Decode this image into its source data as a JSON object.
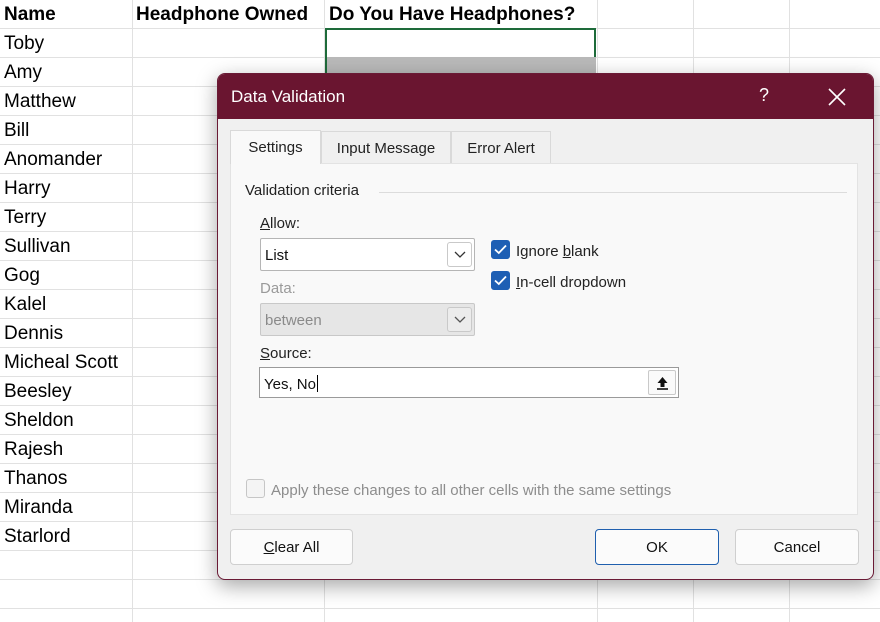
{
  "sheet": {
    "headers": [
      "Name",
      "Headphone Owned",
      "Do You Have Headphones?"
    ],
    "names": [
      "Toby",
      "Amy",
      "Matthew",
      "Bill",
      "Anomander",
      "Harry",
      "Terry",
      "Sullivan",
      "Gog",
      "Kalel",
      "Dennis",
      "Micheal Scott",
      "Beesley",
      "Sheldon",
      "Rajesh",
      "Thanos",
      "Miranda",
      "Starlord"
    ]
  },
  "dialog": {
    "title": "Data Validation",
    "help": "?",
    "tabs": [
      "Settings",
      "Input Message",
      "Error Alert"
    ],
    "active_tab": "Settings",
    "group_label": "Validation criteria",
    "allow_label_pre": "",
    "allow_label_acc": "A",
    "allow_label_post": "llow:",
    "allow_value": "List",
    "data_label": "Data:",
    "data_value": "between",
    "source_label_acc": "S",
    "source_label_post": "ource:",
    "source_value": "Yes, No",
    "ignore_blank_pre": "Ignore ",
    "ignore_blank_acc": "b",
    "ignore_blank_post": "lank",
    "ignore_blank_checked": true,
    "incell_acc": "I",
    "incell_post": "n-cell dropdown",
    "incell_checked": true,
    "apply_all_label": "Apply these changes to all other cells with the same settings",
    "apply_all_checked": false,
    "clear_acc": "C",
    "clear_post": "lear All",
    "ok_label": "OK",
    "cancel_label": "Cancel"
  },
  "colors": {
    "titlebar": "#6a1530",
    "checkbox_on": "#1e5fb4",
    "selection_border": "#1e6b3a"
  },
  "icons": [
    "close-icon",
    "chevron-down-icon",
    "checkmark-icon",
    "collapse-dialog-icon"
  ]
}
